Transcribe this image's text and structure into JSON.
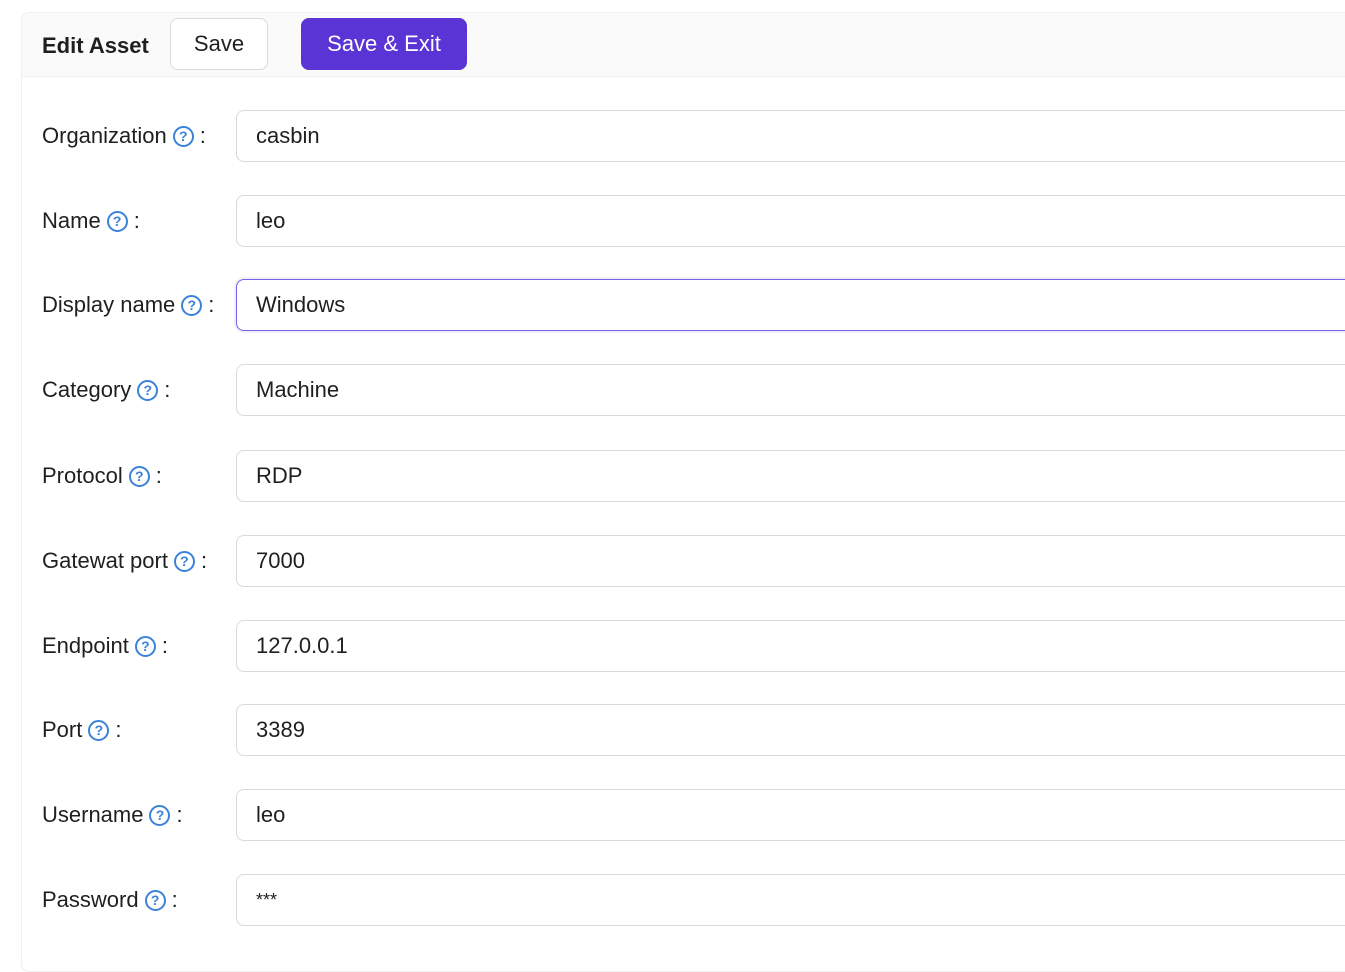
{
  "header": {
    "title": "Edit Asset",
    "save_label": "Save",
    "save_exit_label": "Save & Exit"
  },
  "colors": {
    "primary": "#5a34d5",
    "help_icon": "#3b82d9",
    "focus_border": "#7b5ee0"
  },
  "form": {
    "fields": [
      {
        "label": "Organization",
        "value": "casbin",
        "help_icon": "question-circle-icon"
      },
      {
        "label": "Name",
        "value": "leo",
        "help_icon": "question-circle-icon"
      },
      {
        "label": "Display name",
        "value": "Windows",
        "help_icon": "question-circle-icon",
        "focused": true
      },
      {
        "label": "Category",
        "value": "Machine",
        "help_icon": "question-circle-icon"
      },
      {
        "label": "Protocol",
        "value": "RDP",
        "help_icon": "question-circle-icon"
      },
      {
        "label": "Gatewat port",
        "value": "7000",
        "help_icon": "question-circle-icon"
      },
      {
        "label": "Endpoint",
        "value": "127.0.0.1",
        "help_icon": "question-circle-icon"
      },
      {
        "label": "Port",
        "value": "3389",
        "help_icon": "question-circle-icon"
      },
      {
        "label": "Username",
        "value": "leo",
        "help_icon": "question-circle-icon"
      },
      {
        "label": "Password",
        "value": "***",
        "help_icon": "question-circle-icon"
      }
    ],
    "colon": ":",
    "help_glyph": "?"
  }
}
